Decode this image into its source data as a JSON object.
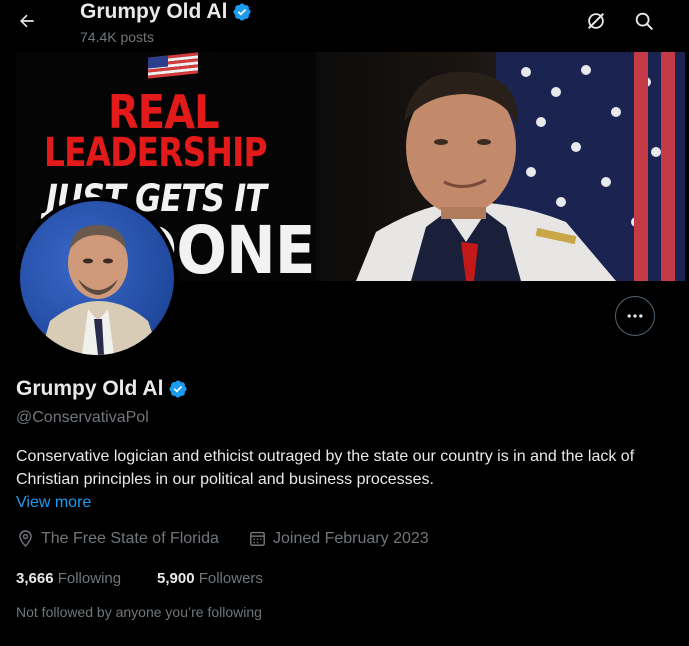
{
  "header": {
    "name": "Grumpy Old Al",
    "posts": "74.4K posts",
    "icons": [
      "back-arrow-icon",
      "verified-badge-icon",
      "grok-icon",
      "search-icon"
    ]
  },
  "banner": {
    "line1": "REAL",
    "line2": "LEADERSHIP",
    "line3": "JUST GETS IT",
    "line4": "DONE"
  },
  "profile": {
    "name": "Grumpy Old Al",
    "handle": "@ConservativaPol",
    "bio": "Conservative logician and ethicist outraged by the state our country is in and the lack of Christian principles in our political and business processes.",
    "view_more": "View more",
    "location": "The Free State of Florida",
    "joined": "Joined February 2023",
    "following_count": "3,666",
    "following_label": "Following",
    "followers_count": "5,900",
    "followers_label": "Followers",
    "not_followed": "Not followed by anyone you’re following"
  },
  "colors": {
    "background": "#000000",
    "text": "#e7e9ea",
    "muted": "#71767b",
    "accent": "#1d9bf0",
    "banner_red": "#e21a1a"
  }
}
